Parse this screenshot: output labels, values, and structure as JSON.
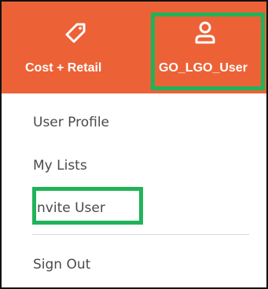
{
  "colors": {
    "topbar": "#ec6236",
    "highlight": "#1fb35a",
    "menu_text": "#4a4a4a",
    "divider": "#d9d9d9"
  },
  "topbar": {
    "cost_retail": {
      "label": "Cost + Retail",
      "icon": "price-tag-icon"
    },
    "user": {
      "label": "GO_LGO_User",
      "icon": "user-icon"
    }
  },
  "menu": {
    "items": [
      {
        "label": "User Profile"
      },
      {
        "label": "My Lists"
      },
      {
        "label": "Invite User"
      },
      {
        "label": "Sign Out"
      }
    ]
  }
}
